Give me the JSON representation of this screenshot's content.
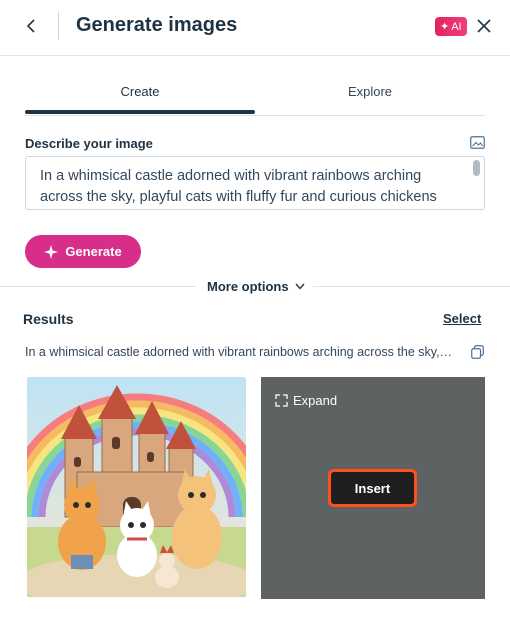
{
  "header": {
    "title": "Generate images",
    "ai_badge": "AI",
    "back_icon": "chevron-left-icon",
    "close_icon": "close-icon"
  },
  "tabs": [
    {
      "label": "Create",
      "active": true
    },
    {
      "label": "Explore",
      "active": false
    }
  ],
  "describe": {
    "label": "Describe your image",
    "icon": "image-icon",
    "prompt_value": "In a whimsical castle adorned with vibrant rainbows arching across the sky, playful cats with fluffy fur and curious chickens"
  },
  "generate_button": {
    "label": "Generate",
    "icon": "sparkle-icon"
  },
  "more_options": {
    "label": "More options",
    "icon": "chevron-down-icon"
  },
  "results": {
    "label": "Results",
    "select_label": "Select",
    "prompt_text": "In a whimsical castle adorned with vibrant rainbows arching across the sky, playful cats with fluffy fur and curious chickens",
    "copy_icon": "copy-icon",
    "images": [
      {
        "alt": "castle-cats-illustration"
      },
      {
        "alt": "blurred-result",
        "expand_label": "Expand",
        "insert_label": "Insert"
      }
    ]
  },
  "colors": {
    "accent": "#d62e89",
    "text_dark": "#213343",
    "insert_border": "#ff4f1f"
  }
}
